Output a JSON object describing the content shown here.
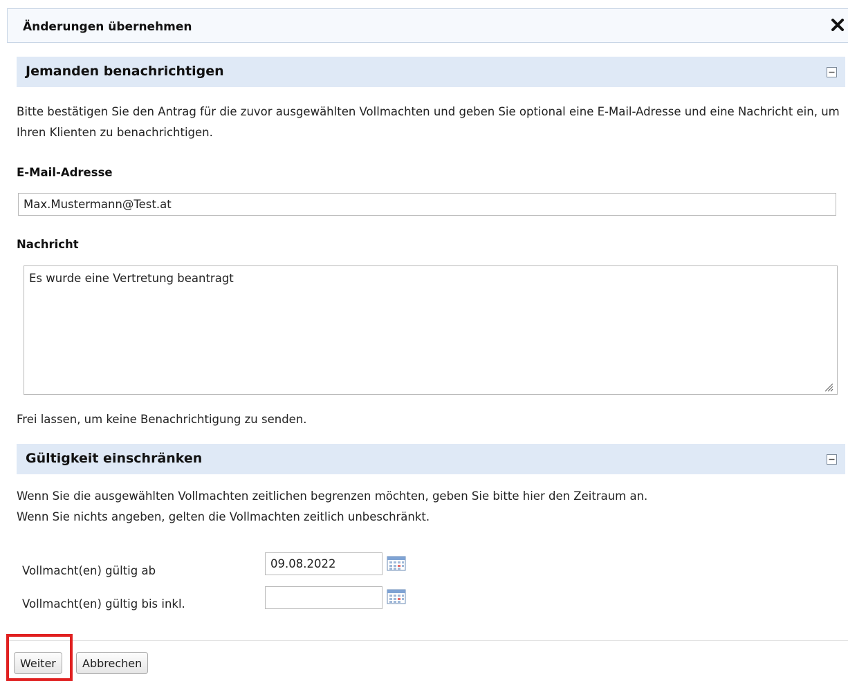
{
  "dialog": {
    "title": "Änderungen übernehmen"
  },
  "notify_section": {
    "title": "Jemanden benachrichtigen",
    "intro": "Bitte bestätigen Sie den Antrag für die zuvor ausgewählten Vollmachten und geben Sie optional eine E-Mail-Adresse und eine Nachricht ein, um Ihren Klienten zu benachrichtigen.",
    "email_label": "E-Mail-Adresse",
    "email_value": "Max.Mustermann@Test.at",
    "message_label": "Nachricht",
    "message_value": "Es wurde eine Vertretung beantragt",
    "hint": "Frei lassen, um keine Benachrichtigung zu senden."
  },
  "validity_section": {
    "title": "Gültigkeit einschränken",
    "intro_line1": "Wenn Sie die ausgewählten Vollmachten zeitlichen begrenzen möchten, geben Sie bitte hier den Zeitraum an.",
    "intro_line2": "Wenn Sie nichts angeben, gelten die Vollmachten zeitlich unbeschränkt.",
    "from_label": "Vollmacht(en) gültig ab",
    "from_value": "09.08.2022",
    "to_label": "Vollmacht(en) gültig bis inkl.",
    "to_value": ""
  },
  "footer": {
    "next_label": "Weiter",
    "cancel_label": "Abbrechen"
  },
  "icons": {
    "close": "close-icon",
    "collapse": "collapse-icon",
    "calendar": "calendar-icon",
    "resize": "resize-grip-icon"
  },
  "colors": {
    "section_header_bg": "#dfe9f6",
    "titlebar_bg": "#f6f9fd",
    "highlight": "#e02020"
  }
}
